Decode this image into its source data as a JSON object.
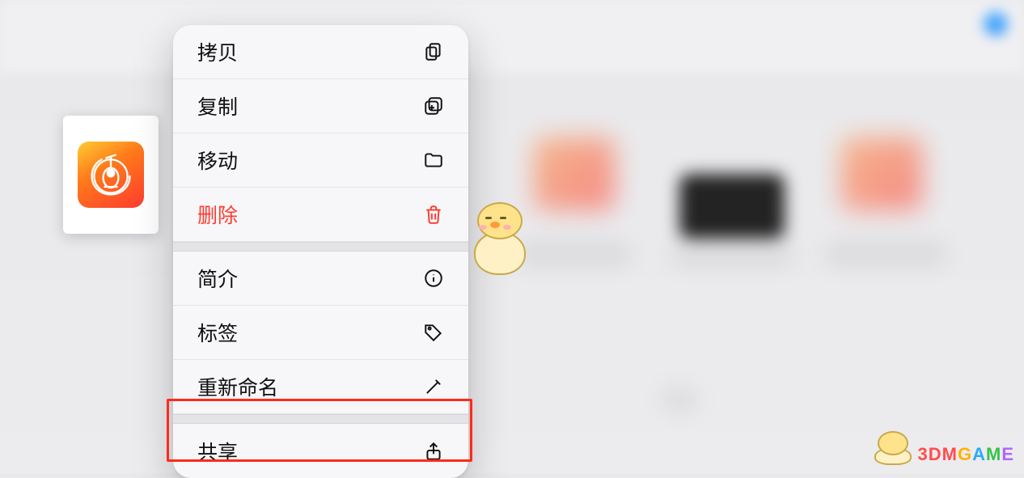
{
  "file": {
    "app_icon": "garageband-icon"
  },
  "menu": {
    "groups": [
      [
        {
          "id": "copy",
          "label": "拷贝",
          "icon": "doc-on-doc-icon",
          "destructive": false
        },
        {
          "id": "duplicate",
          "label": "复制",
          "icon": "plus-square-on-square-icon",
          "destructive": false
        },
        {
          "id": "move",
          "label": "移动",
          "icon": "folder-icon",
          "destructive": false
        },
        {
          "id": "delete",
          "label": "删除",
          "icon": "trash-icon",
          "destructive": true
        }
      ],
      [
        {
          "id": "info",
          "label": "简介",
          "icon": "info-circle-icon",
          "destructive": false
        },
        {
          "id": "tags",
          "label": "标签",
          "icon": "tag-icon",
          "destructive": false
        },
        {
          "id": "rename",
          "label": "重新命名",
          "icon": "pencil-icon",
          "destructive": false
        }
      ],
      [
        {
          "id": "share",
          "label": "共享",
          "icon": "share-icon",
          "destructive": false
        }
      ]
    ]
  },
  "highlight_target": "share",
  "watermark": {
    "text": "3DMGAME"
  },
  "colors": {
    "destructive": "#ff3b30",
    "highlight_border": "#ff2a1a",
    "menu_bg": "#f7f7f9"
  }
}
